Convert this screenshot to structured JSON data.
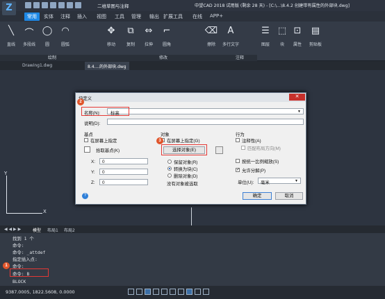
{
  "window": {
    "title": "中望CAD 2018 试用版 (剩余 28 天) - [C:\\...\\8.4.2 创建带有属性的外部块.dwg]",
    "workspace": "二维草图与注释"
  },
  "ribbon_tabs": [
    "常用",
    "实体",
    "注释",
    "插入",
    "视图",
    "工具",
    "管理",
    "输出",
    "扩展工具",
    "在线",
    "APP+"
  ],
  "ribbon_tools": [
    {
      "label": "直线",
      "icon": "line-icon"
    },
    {
      "label": "多段线",
      "icon": "polyline-icon"
    },
    {
      "label": "圆",
      "icon": "circle-icon"
    },
    {
      "label": "圆弧",
      "icon": "arc-icon"
    },
    {
      "label": "移动",
      "icon": "move-icon"
    },
    {
      "label": "复制",
      "icon": "copy-icon"
    },
    {
      "label": "拉伸",
      "icon": "stretch-icon"
    },
    {
      "label": "圆角",
      "icon": "fillet-icon"
    },
    {
      "label": "擦除",
      "icon": "erase-icon"
    },
    {
      "label": "多行文字",
      "icon": "mtext-icon"
    },
    {
      "label": "图层",
      "icon": "layer-icon"
    },
    {
      "label": "块",
      "icon": "block-icon"
    },
    {
      "label": "属性",
      "icon": "attribute-icon"
    },
    {
      "label": "剪贴板",
      "icon": "clipboard-icon"
    }
  ],
  "ribbon_groups": [
    "绘制",
    "修改",
    "注释"
  ],
  "doc_tabs": [
    "Drawing1.dwg",
    "8.4....的外部块.dwg"
  ],
  "dialog": {
    "title": "块定义",
    "name_label": "名称(N):",
    "name_value": "标高",
    "desc_label": "说明(D):",
    "desc_value": "",
    "base_group": "基点",
    "base_on_screen": "在屏幕上指定",
    "pick_point": "拾取基点(K)",
    "x_label": "X:",
    "x_value": "0",
    "y_label": "Y:",
    "y_value": "0",
    "z_label": "Z:",
    "z_value": "0",
    "obj_group": "对象",
    "obj_on_screen": "在屏幕上指定(G)",
    "select_objects": "选择对象(E)",
    "retain": "保留对象(R)",
    "convert": "转换为块(C)",
    "delete": "删除对象(D)",
    "no_selection": "没有对象被选取",
    "behavior_group": "行为",
    "annotative": "注释性(A)",
    "match_orient": "匹配布局方向(M)",
    "scale_uniform": "按统一比例缩放(S)",
    "allow_explode": "允许分解(P)",
    "unit_label": "单位(U):",
    "unit_value": "毫米",
    "ok": "确定",
    "cancel": "取消",
    "help": "?"
  },
  "badges": {
    "b1": "1",
    "b2": "2",
    "b3": "3"
  },
  "layout_tabs": [
    "模型",
    "布局1",
    "布局2"
  ],
  "command_lines": [
    "找到 1 个",
    "命令:",
    "命令:  _attdef",
    "指定插入点:",
    "命令:",
    "命令: B",
    "BLOCK"
  ],
  "status": {
    "coords": "9387.0005, 1822.5608, 0.0000"
  },
  "ucs": {
    "x": "X",
    "y": "Y"
  },
  "accent": "#1e88e5"
}
